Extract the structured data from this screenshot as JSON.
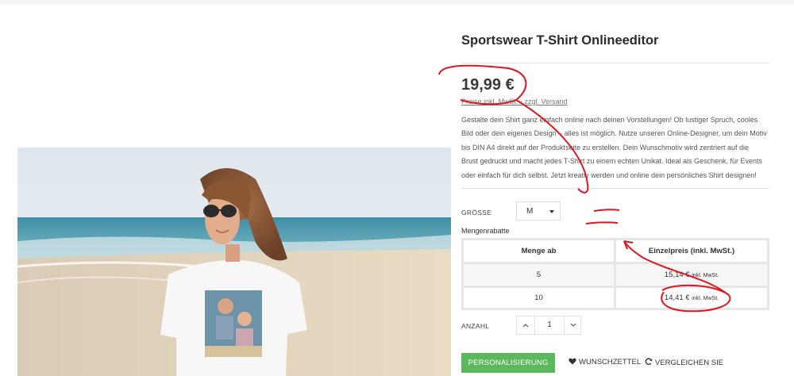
{
  "product": {
    "title": "Sportswear T-Shirt Onlineeditor",
    "price": "19,99 €",
    "price_note": "Preise inkl. MwSt. - zzgl. Versand",
    "description": "Gestalte dein Shirt ganz einfach online nach deinen Vorstellungen! Ob lustiger Spruch, cooles Bild oder dein eigenes Design – alles ist möglich. Nutze unseren Online-Designer, um dein Motiv bis DIN A4 direkt auf der Produktseite zu erstellen. Dein Wunschmotiv wird zentriert auf die Brust gedruckt und macht jedes T-Shirt zu einem echten Unikat. Ideal als Geschenk, für Events oder einfach für dich selbst. Jetzt kreativ werden und online dein persönliches Shirt designen!"
  },
  "size": {
    "label": "GRÖSSE",
    "selected": "M"
  },
  "bulk": {
    "label": "Mengenrabatte",
    "headers": [
      "Menge ab",
      "Einzelpreis (inkl. MwSt.)"
    ],
    "rows": [
      {
        "qty": "5",
        "price": "15,14 €",
        "tax": "inkl. MwSt."
      },
      {
        "qty": "10",
        "price": "14,41 €",
        "tax": "inkl. MwSt."
      }
    ]
  },
  "quantity": {
    "label": "ANZAHL",
    "value": "1"
  },
  "actions": {
    "personalize": "PERSONALISIERUNG",
    "wishlist": "WUNSCHZETTEL",
    "compare": "VERGLEICHEN SIE"
  },
  "colors": {
    "accent_green": "#5cb85c",
    "annotation_red": "#e0141e"
  }
}
